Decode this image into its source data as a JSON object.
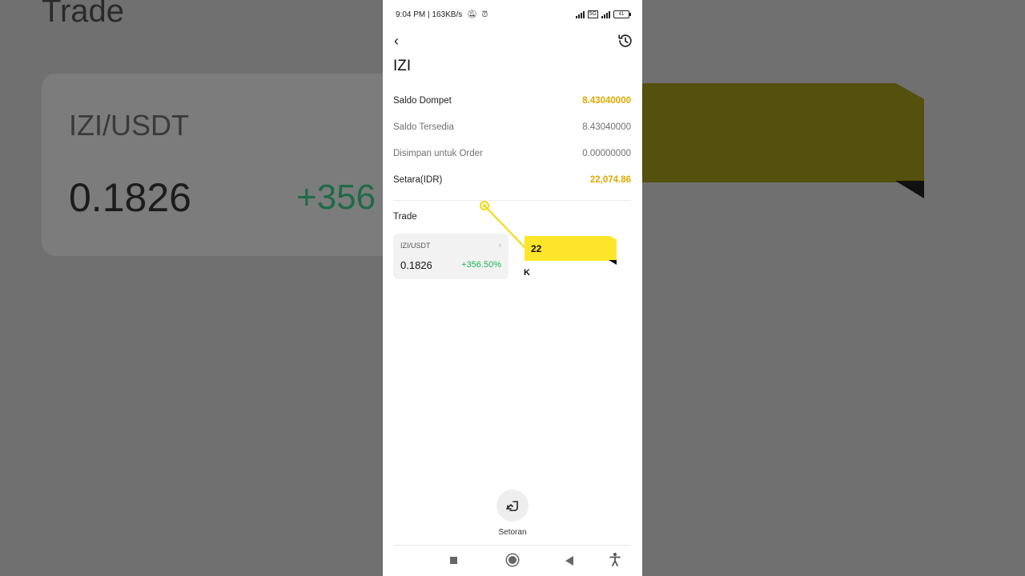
{
  "background": {
    "title": "Trade",
    "pair": "IZI/USDT",
    "price": "0.1826",
    "change": "+356"
  },
  "status_bar": {
    "time": "9:04 PM",
    "speed": "163KB/s",
    "network_tag": "5G",
    "battery": "41"
  },
  "page": {
    "title": "IZI"
  },
  "balances": [
    {
      "label": "Saldo Dompet",
      "value": "8.43040000"
    },
    {
      "label": "Saldo Tersedia",
      "value": "8.43040000"
    },
    {
      "label": "Disimpan untuk Order",
      "value": "0.00000000"
    },
    {
      "label": "Setara(IDR)",
      "value": "22,074.86"
    }
  ],
  "trade": {
    "section_title": "Trade",
    "pair": "IZI/USDT",
    "price": "0.1826",
    "change": "+356.50%"
  },
  "overlay": {
    "flag_text": "22",
    "below_text": "K"
  },
  "deposit": {
    "label": "Setoran"
  },
  "colors": {
    "gold": "#e0a800",
    "green": "#1fb35a",
    "highlight_yellow": "#fde62a"
  }
}
